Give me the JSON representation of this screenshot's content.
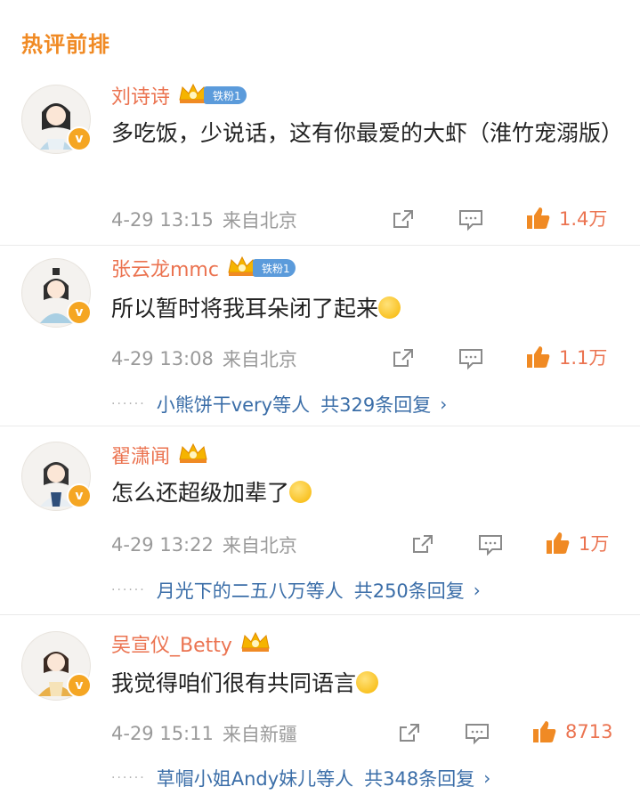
{
  "section": {
    "title": "热评前排"
  },
  "colors": {
    "accent": "#f08a24",
    "username": "#eb7350",
    "link": "#3b6ea8",
    "fan_badge": "#5b9bdb",
    "meta": "#9a9a9a"
  },
  "icons": {
    "share": "share-icon",
    "comment": "comment-icon",
    "like": "thumbs-up-icon",
    "verified": "verified-v-icon",
    "crown": "crown-icon"
  },
  "comments": [
    {
      "username": "刘诗诗",
      "badge": "铁粉1",
      "content": "多吃饭，少说话，这有你最爱的大虾（淮竹宠溺版）",
      "time": "4-29 13:15",
      "location": "来自北京",
      "likes": "1.4万",
      "verified_mark": "v"
    },
    {
      "username": "张云龙mmc",
      "badge": "铁粉1",
      "content": "所以暂时将我耳朵闭了起来",
      "time": "4-29 13:08",
      "location": "来自北京",
      "likes": "1.1万",
      "verified_mark": "v",
      "reply_names": "小熊饼干very",
      "reply_suffix": "等人",
      "reply_total": "共329条回复"
    },
    {
      "username": "翟潇闻",
      "content": "怎么还超级加辈了",
      "time": "4-29 13:22",
      "location": "来自北京",
      "likes": "1万",
      "verified_mark": "v",
      "reply_names": "月光下的二五八万",
      "reply_suffix": "等人",
      "reply_total": "共250条回复"
    },
    {
      "username": "吴宣仪_Betty",
      "content": "我觉得咱们很有共同语言",
      "time": "4-29 15:11",
      "location": "来自新疆",
      "likes": "8713",
      "verified_mark": "v",
      "reply_names": "草帽小姐Andy妹儿",
      "reply_suffix": "等人",
      "reply_total": "共348条回复"
    }
  ],
  "reply_dots": "······",
  "chevron": "›"
}
